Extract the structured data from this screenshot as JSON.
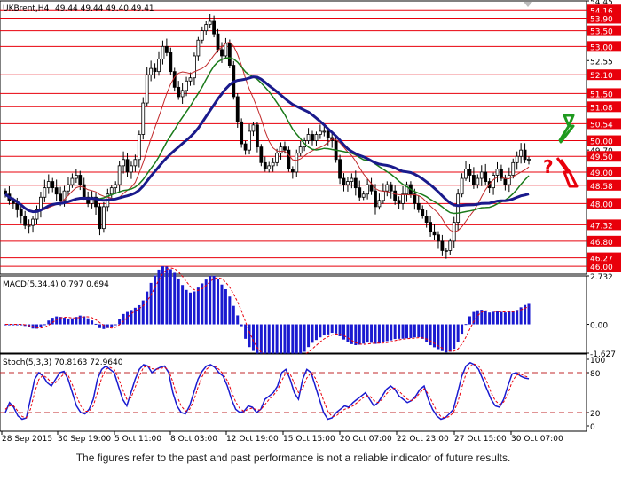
{
  "chart_data": [
    {
      "type": "candlestick",
      "title": "UKBrent,H4",
      "ohlc_text": "49.44 49.44 49.40 49.41",
      "ylim": [
        45.75,
        54.45
      ],
      "price_ticks": [
        "54.45",
        "54.16",
        "53.90",
        "53.50",
        "53.00",
        "52.55",
        "52.10",
        "51.50",
        "51.08",
        "50.54",
        "50.00",
        "49.70",
        "49.50",
        "49.00",
        "48.58",
        "48.00",
        "47.32",
        "46.80",
        "46.27",
        "46.00"
      ],
      "highlighted_ticks": [
        "54.16",
        "53.90",
        "53.50",
        "53.00",
        "52.10",
        "51.50",
        "51.08",
        "50.54",
        "50.00",
        "49.50",
        "49.00",
        "48.58",
        "48.00",
        "47.32",
        "46.80",
        "46.27",
        "46.00"
      ],
      "level_color": "#e8000b",
      "x_labels": [
        "28 Sep 2015",
        "30 Sep 19:00",
        "5 Oct 11:00",
        "8 Oct 03:00",
        "12 Oct 19:00",
        "15 Oct 15:00",
        "20 Oct 07:00",
        "22 Oct 23:00",
        "27 Oct 15:00",
        "30 Oct 07:00"
      ],
      "close": [
        48.3,
        48.1,
        48.0,
        47.8,
        47.6,
        47.3,
        47.3,
        47.5,
        47.8,
        48.2,
        48.5,
        48.7,
        48.5,
        48.3,
        48.1,
        48.4,
        48.6,
        48.8,
        48.9,
        48.6,
        48.2,
        48.0,
        48.2,
        47.9,
        47.2,
        47.9,
        48.3,
        48.5,
        48.6,
        49.2,
        49.4,
        49.0,
        49.2,
        49.4,
        50.2,
        51.2,
        52.1,
        52.3,
        52.2,
        52.6,
        53.0,
        52.8,
        52.2,
        51.7,
        51.4,
        51.6,
        51.9,
        52.0,
        52.7,
        53.2,
        53.5,
        53.7,
        53.8,
        53.4,
        52.9,
        52.7,
        53.1,
        52.4,
        51.4,
        50.6,
        49.9,
        49.7,
        50.3,
        50.5,
        49.8,
        49.3,
        49.1,
        49.2,
        49.3,
        49.6,
        49.8,
        49.7,
        49.1,
        49.0,
        49.6,
        49.8,
        50.0,
        50.2,
        50.0,
        50.2,
        50.3,
        50.3,
        50.1,
        50.0,
        49.4,
        48.8,
        48.6,
        48.7,
        48.8,
        48.5,
        48.2,
        48.3,
        48.6,
        48.4,
        47.9,
        48.1,
        48.4,
        48.6,
        48.4,
        48.1,
        48.0,
        48.3,
        48.6,
        48.3,
        48.0,
        47.8,
        47.6,
        47.4,
        47.1,
        47.0,
        46.8,
        46.5,
        46.5,
        46.8,
        47.4,
        48.3,
        48.8,
        49.1,
        48.9,
        48.6,
        48.8,
        49.0,
        48.7,
        48.5,
        48.9,
        49.1,
        48.8,
        48.6,
        48.9,
        49.3,
        49.5,
        49.7,
        49.4,
        49.41
      ],
      "indicators": [
        "MA (thin red)",
        "MA (green)",
        "MA (navy, thick)"
      ]
    },
    {
      "type": "bar",
      "title": "MACD(5,34,4) 0.797 0.694",
      "ylim": [
        -1.627,
        2.732
      ],
      "ticks": [
        "2.732",
        "0.00",
        "-1.627"
      ],
      "signal_style": "red dashed"
    },
    {
      "type": "line",
      "title": "Stoch(5,3,3) 70.8163 72.9640",
      "ylim": [
        0,
        100
      ],
      "ticks": [
        "100",
        "80",
        "20",
        "0"
      ],
      "levels": [
        80,
        20
      ],
      "series": [
        {
          "style": "blue solid",
          "values": [
            20,
            35,
            28,
            15,
            10,
            12,
            40,
            70,
            80,
            75,
            65,
            60,
            70,
            80,
            82,
            70,
            50,
            30,
            20,
            18,
            25,
            40,
            70,
            85,
            90,
            85,
            80,
            60,
            40,
            30,
            50,
            70,
            85,
            92,
            90,
            80,
            85,
            88,
            90,
            80,
            50,
            30,
            20,
            18,
            30,
            50,
            70,
            82,
            90,
            92,
            88,
            80,
            75,
            60,
            40,
            25,
            20,
            22,
            30,
            28,
            20,
            25,
            40,
            45,
            50,
            60,
            80,
            85,
            70,
            50,
            40,
            70,
            85,
            80,
            60,
            40,
            20,
            10,
            12,
            20,
            25,
            30,
            28,
            35,
            40,
            45,
            50,
            40,
            30,
            35,
            45,
            55,
            60,
            55,
            45,
            40,
            35,
            38,
            45,
            55,
            60,
            40,
            25,
            15,
            10,
            12,
            18,
            25,
            50,
            75,
            90,
            95,
            92,
            85,
            70,
            55,
            40,
            30,
            28,
            40,
            60,
            78,
            80,
            75,
            72,
            70.8
          ]
        },
        {
          "style": "red dashed",
          "values": [
            25,
            30,
            30,
            22,
            14,
            12,
            25,
            50,
            70,
            76,
            72,
            65,
            65,
            72,
            78,
            76,
            62,
            45,
            30,
            22,
            22,
            30,
            50,
            72,
            85,
            88,
            85,
            72,
            55,
            40,
            42,
            58,
            75,
            88,
            90,
            86,
            85,
            86,
            88,
            84,
            66,
            45,
            30,
            22,
            25,
            38,
            58,
            74,
            85,
            90,
            90,
            85,
            78,
            68,
            52,
            36,
            26,
            22,
            25,
            27,
            24,
            24,
            32,
            40,
            46,
            54,
            68,
            80,
            78,
            64,
            50,
            56,
            72,
            80,
            72,
            56,
            38,
            22,
            14,
            15,
            20,
            25,
            27,
            30,
            35,
            40,
            45,
            45,
            38,
            35,
            40,
            48,
            55,
            57,
            52,
            46,
            40,
            38,
            42,
            50,
            56,
            48,
            35,
            22,
            14,
            12,
            14,
            20,
            35,
            58,
            78,
            90,
            93,
            90,
            80,
            66,
            50,
            38,
            32,
            36,
            48,
            66,
            76,
            78,
            75,
            72.96
          ]
        }
      ]
    }
  ],
  "disclaimer": "The figures refer to the past and past performance is not a reliable indicator of future results."
}
